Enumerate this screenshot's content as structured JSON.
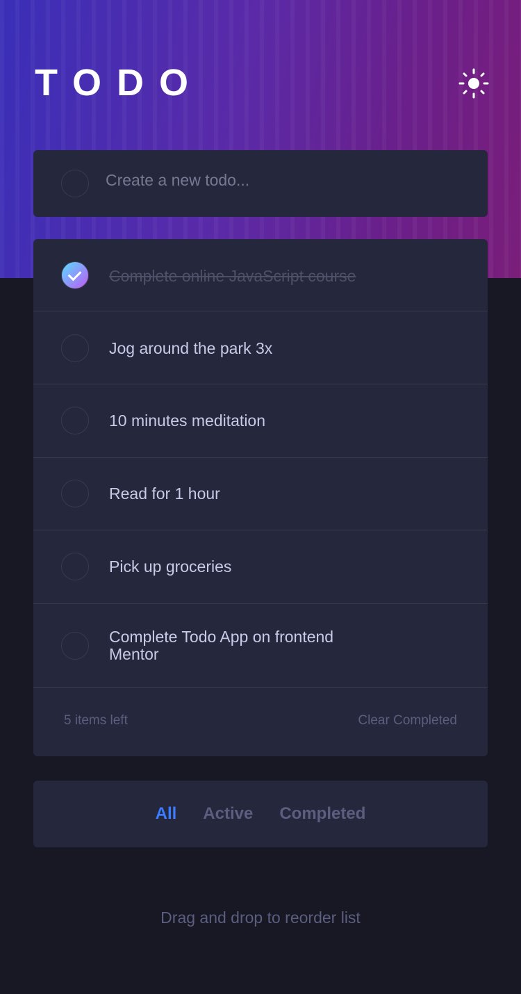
{
  "header": {
    "title": "TODO",
    "theme_toggle": "sun-icon"
  },
  "new_todo": {
    "placeholder": "Create a new todo..."
  },
  "todos": [
    {
      "text": "Complete online JavaScript course",
      "completed": true
    },
    {
      "text": "Jog around the park 3x",
      "completed": false
    },
    {
      "text": "10 minutes meditation",
      "completed": false
    },
    {
      "text": "Read for 1 hour",
      "completed": false
    },
    {
      "text": "Pick up groceries",
      "completed": false
    },
    {
      "text": "Complete Todo App on frontend Mentor",
      "completed": false
    }
  ],
  "footer": {
    "items_left": "5 items left",
    "clear": "Clear Completed"
  },
  "filters": [
    {
      "label": "All",
      "active": true
    },
    {
      "label": "Active",
      "active": false
    },
    {
      "label": "Completed",
      "active": false
    }
  ],
  "hint": "Drag and drop to reorder list",
  "colors": {
    "accent": "#3a7cfd",
    "card": "#25273c",
    "bg": "#181824"
  }
}
